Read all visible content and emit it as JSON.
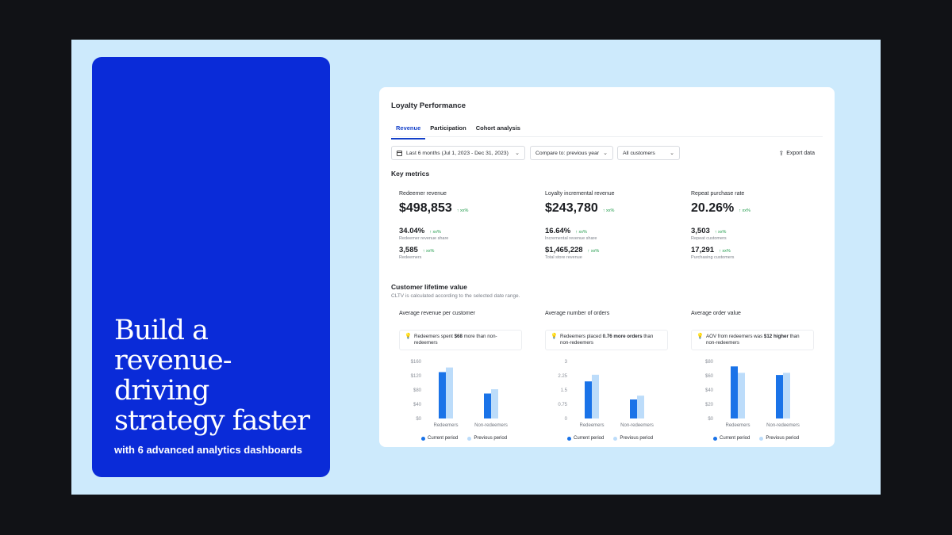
{
  "promo": {
    "headline": "Build a revenue-driving strategy faster",
    "subline": "with 6 advanced analytics dashboards"
  },
  "dashboard": {
    "title": "Loyalty Performance",
    "tabs": [
      "Revenue",
      "Participation",
      "Cohort analysis"
    ],
    "active_tab": "Revenue",
    "filters": {
      "date": "Last 6 months (Jul 1, 2023 - Dec 31, 2023)",
      "compare": "Compare to: previous year",
      "segment": "All customers"
    },
    "export_label": "Export data",
    "key_metrics_title": "Key metrics",
    "metrics": [
      {
        "label": "Redeemer revenue",
        "value": "$498,853",
        "delta": "↑ xx%",
        "sub1_value": "34.04%",
        "sub1_delta": "↑ xx%",
        "sub1_caption": "Redeemer revenue share",
        "sub2_value": "3,585",
        "sub2_delta": "↑ xx%",
        "sub2_caption": "Redeemers"
      },
      {
        "label": "Loyalty incremental revenue",
        "value": "$243,780",
        "delta": "↑ xx%",
        "sub1_value": "16.64%",
        "sub1_delta": "↑ xx%",
        "sub1_caption": "Incremental revenue share",
        "sub2_value": "$1,465,228",
        "sub2_delta": "↑ xx%",
        "sub2_caption": "Total store revenue"
      },
      {
        "label": "Repeat purchase rate",
        "value": "20.26%",
        "delta": "↑ xx%",
        "sub1_value": "3,503",
        "sub1_delta": "↑ xx%",
        "sub1_caption": "Repeat customers",
        "sub2_value": "17,291",
        "sub2_delta": "↑ xx%",
        "sub2_caption": "Purchasing customers"
      }
    ],
    "cltv_title": "Customer lifetime value",
    "cltv_subtitle": "CLTV is calculated according to the selected date range."
  },
  "colors": {
    "current": "#1a73e8",
    "previous": "#bcdcfa",
    "promo_bg": "#0a2bd8",
    "stage_bg": "#cdeafc",
    "positive": "#1f9a4a"
  },
  "chart_data": [
    {
      "type": "bar",
      "title": "Average revenue per customer",
      "insight_pre": "Redeemers spent ",
      "insight_bold": "$68",
      "insight_post": " more than non-redeemers",
      "categories": [
        "Redeemers",
        "Non-redeemers"
      ],
      "yticks": [
        "$160",
        "$120",
        "$80",
        "$40",
        "$0"
      ],
      "ylim": [
        0,
        160
      ],
      "series": [
        {
          "name": "Current period",
          "values": [
            130,
            70
          ]
        },
        {
          "name": "Previous period",
          "values": [
            143,
            82
          ]
        }
      ]
    },
    {
      "type": "bar",
      "title": "Average number of orders",
      "insight_pre": "Redeemers placed ",
      "insight_bold": "0.76 more orders",
      "insight_post": " than non-redeemers",
      "categories": [
        "Redeemers",
        "Non-redeemers"
      ],
      "yticks": [
        "3",
        "2.25",
        "1.5",
        "0.75",
        "0"
      ],
      "ylim": [
        0,
        3
      ],
      "series": [
        {
          "name": "Current period",
          "values": [
            1.95,
            1.0
          ]
        },
        {
          "name": "Previous period",
          "values": [
            2.3,
            1.2
          ]
        }
      ]
    },
    {
      "type": "bar",
      "title": "Average order value",
      "insight_pre": "AOV from redeemers was ",
      "insight_bold": "$12 higher",
      "insight_post": " than non-redeemers",
      "categories": [
        "Redeemers",
        "Non-redeemers"
      ],
      "yticks": [
        "$80",
        "$60",
        "$40",
        "$20",
        "$0"
      ],
      "ylim": [
        0,
        80
      ],
      "series": [
        {
          "name": "Current period",
          "values": [
            73,
            61
          ]
        },
        {
          "name": "Previous period",
          "values": [
            64,
            64
          ]
        }
      ]
    }
  ]
}
